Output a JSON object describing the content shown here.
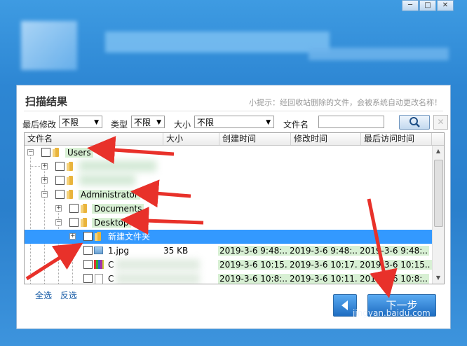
{
  "window_controls": {
    "minimize": "─",
    "maximize": "□",
    "close": "✕"
  },
  "dialog": {
    "title": "扫描结果",
    "tip": "小提示：经回收站删除的文件，会被系统自动更改名称！"
  },
  "filters": {
    "last_modified_label": "最后修改",
    "last_modified_value": "不限",
    "type_label": "类型",
    "type_value": "不限",
    "size_label": "大小",
    "size_value": "不限",
    "filename_label": "文件名",
    "filename_value": ""
  },
  "columns": [
    "文件名",
    "大小",
    "创建时间",
    "修改时间",
    "最后访问时间"
  ],
  "tree": {
    "users": "Users",
    "administrator": "Administrator",
    "documents": "Documents",
    "desktop": "Desktop",
    "new_folder": "新建文件夹"
  },
  "files": [
    {
      "name": "1.jpg",
      "size": "35 KB",
      "created": "2019-3-6 9:48:..",
      "modified": "2019-3-6 9:48:..",
      "accessed": "2019-3-6 9:48:.."
    },
    {
      "name": "C",
      "size": "",
      "created": "2019-3-6 10:15..",
      "modified": "2019-3-6 10:17..",
      "accessed": "2019-3-6 10:15.."
    },
    {
      "name": "C",
      "size": "",
      "created": "2019-3-6 10:8:..",
      "modified": "2019-3-6 10:11..",
      "accessed": "2019-3-6 10:8:.."
    }
  ],
  "links": {
    "select_all": "全选",
    "invert": "反选"
  },
  "buttons": {
    "back_icon": "left-arrow-icon",
    "next": "下一步"
  },
  "watermark": "jingyan.baidu.com",
  "colors": {
    "accent": "#3399ff",
    "highlight": "#d8f0d4",
    "annotation_arrow": "#e8312a",
    "app_bg": "#2f8bd6"
  }
}
